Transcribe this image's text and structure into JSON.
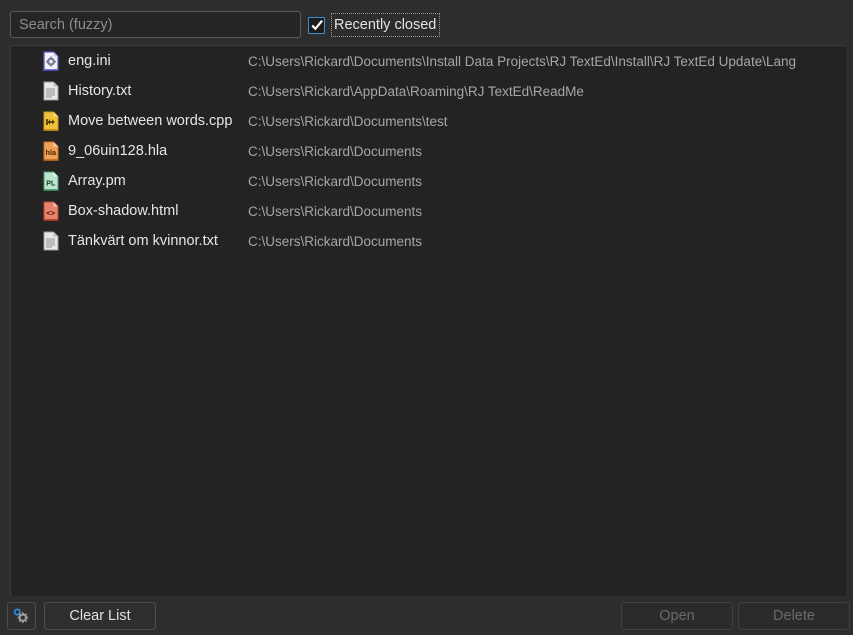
{
  "search": {
    "placeholder": "Search (fuzzy)",
    "value": ""
  },
  "filter": {
    "recently_closed_label": "Recently closed",
    "recently_closed_checked": true
  },
  "files": [
    {
      "name": "eng.ini",
      "path": "C:\\Users\\Rickard\\Documents\\Install Data Projects\\RJ TextEd\\Install\\RJ TextEd Update\\Lang",
      "icon": "ini-file-icon"
    },
    {
      "name": "History.txt",
      "path": "C:\\Users\\Rickard\\AppData\\Roaming\\RJ TextEd\\ReadMe",
      "icon": "text-file-icon"
    },
    {
      "name": "Move between words.cpp",
      "path": "C:\\Users\\Rickard\\Documents\\test",
      "icon": "cpp-file-icon"
    },
    {
      "name": "9_06uin128.hla",
      "path": "C:\\Users\\Rickard\\Documents",
      "icon": "hla-file-icon"
    },
    {
      "name": "Array.pm",
      "path": "C:\\Users\\Rickard\\Documents",
      "icon": "perl-file-icon"
    },
    {
      "name": "Box-shadow.html",
      "path": "C:\\Users\\Rickard\\Documents",
      "icon": "html-file-icon"
    },
    {
      "name": "Tänkvärt om kvinnor.txt",
      "path": "C:\\Users\\Rickard\\Documents",
      "icon": "text-file-icon"
    }
  ],
  "toolbar": {
    "settings_icon": "gear-icon",
    "clear_label": "Clear List",
    "open_label": "Open",
    "delete_label": "Delete",
    "open_enabled": false,
    "delete_enabled": false
  },
  "colors": {
    "window_bg": "#2d2d2d",
    "panel_bg": "#232323",
    "accent": "#3f8fd0",
    "text": "#e6e6e6",
    "muted_text": "#a6a6a6",
    "disabled_text": "#6a6a6a"
  }
}
